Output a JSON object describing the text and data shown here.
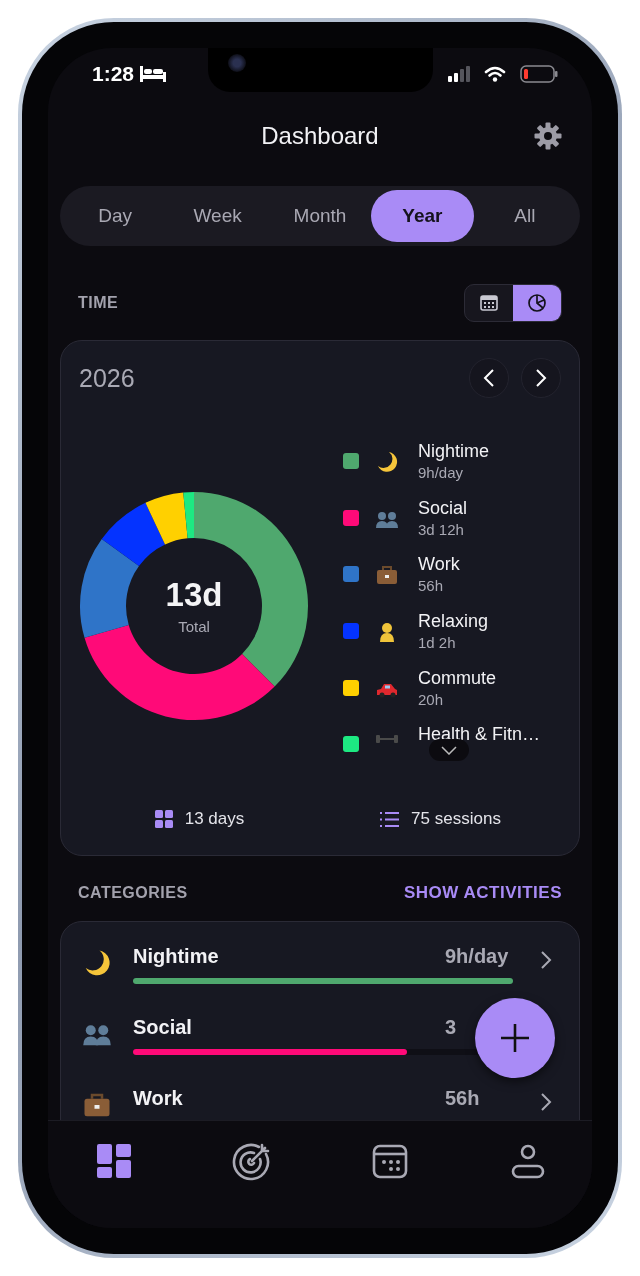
{
  "status_bar": {
    "time": "1:28"
  },
  "header": {
    "title": "Dashboard"
  },
  "range_tabs": [
    {
      "label": "Day",
      "selected": false
    },
    {
      "label": "Week",
      "selected": false
    },
    {
      "label": "Month",
      "selected": false
    },
    {
      "label": "Year",
      "selected": true
    },
    {
      "label": "All",
      "selected": false
    }
  ],
  "time_section": {
    "title": "TIME",
    "view_toggle": [
      {
        "kind": "calendar",
        "selected": false
      },
      {
        "kind": "pie",
        "selected": true
      }
    ]
  },
  "time_card": {
    "period": "2026",
    "total": "13d",
    "total_label": "Total",
    "chart_data": {
      "type": "donut",
      "categories": [
        "Nightime",
        "Social",
        "Work",
        "Relaxing",
        "Commute",
        "Health & Fitn…"
      ],
      "values": [
        37.5,
        33,
        14.5,
        8,
        5.5,
        1.5
      ]
    },
    "legend": [
      {
        "value": "9h/day",
        "color": "#4fa86e"
      },
      {
        "value": "3d 12h",
        "color": "#ff0a78"
      },
      {
        "value": "56h",
        "color": "#2f74c8"
      },
      {
        "value": "1d 2h",
        "color": "#0433ff"
      },
      {
        "value": "20h",
        "color": "#ffd000"
      },
      {
        "color": "#1de982"
      }
    ],
    "stats": [
      {
        "kind": "days",
        "text": "13 days"
      },
      {
        "kind": "sessions",
        "text": "75 sessions"
      }
    ]
  },
  "categories_section": {
    "title": "CATEGORIES",
    "action": "SHOW ACTIVITIES"
  },
  "categories": [
    {
      "name": "Nightime",
      "value": "9h/day",
      "color": "#4fa86e",
      "level": 1
    },
    {
      "name": "Social",
      "value": "3",
      "color": "#ff0a78",
      "level": 0.72
    },
    {
      "name": "Work",
      "value": "56h"
    }
  ],
  "bottom_nav": [
    {
      "kind": "dashboard",
      "selected": true
    },
    {
      "kind": "goals",
      "selected": false
    },
    {
      "kind": "calendar",
      "selected": false
    },
    {
      "kind": "profile",
      "selected": false
    }
  ]
}
